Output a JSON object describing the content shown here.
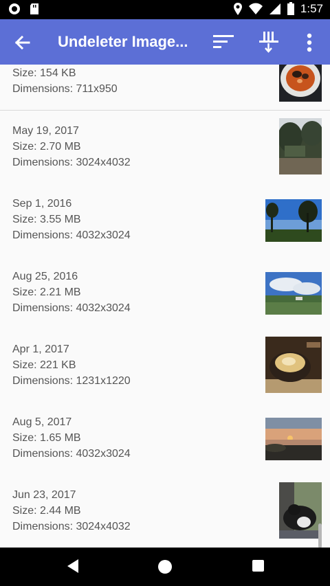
{
  "status_bar": {
    "time": "1:57"
  },
  "app_bar": {
    "title": "Undeleter Image..."
  },
  "items": [
    {
      "date": "",
      "size": "Size: 154 KB",
      "dimensions": "Dimensions: 711x950"
    },
    {
      "date": "May 19, 2017",
      "size": "Size: 2.70 MB",
      "dimensions": "Dimensions: 3024x4032"
    },
    {
      "date": "Sep 1, 2016",
      "size": "Size: 3.55 MB",
      "dimensions": "Dimensions: 4032x3024"
    },
    {
      "date": "Aug 25, 2016",
      "size": "Size: 2.21 MB",
      "dimensions": "Dimensions: 4032x3024"
    },
    {
      "date": "Apr 1, 2017",
      "size": "Size: 221 KB",
      "dimensions": "Dimensions: 1231x1220"
    },
    {
      "date": "Aug 5, 2017",
      "size": "Size: 1.65 MB",
      "dimensions": "Dimensions: 4032x3024"
    },
    {
      "date": "Jun 23, 2017",
      "size": "Size: 2.44 MB",
      "dimensions": "Dimensions: 3024x4032"
    }
  ],
  "colors": {
    "app_bar": "#5c6fd6",
    "background": "#fafafa",
    "text": "#555555"
  }
}
